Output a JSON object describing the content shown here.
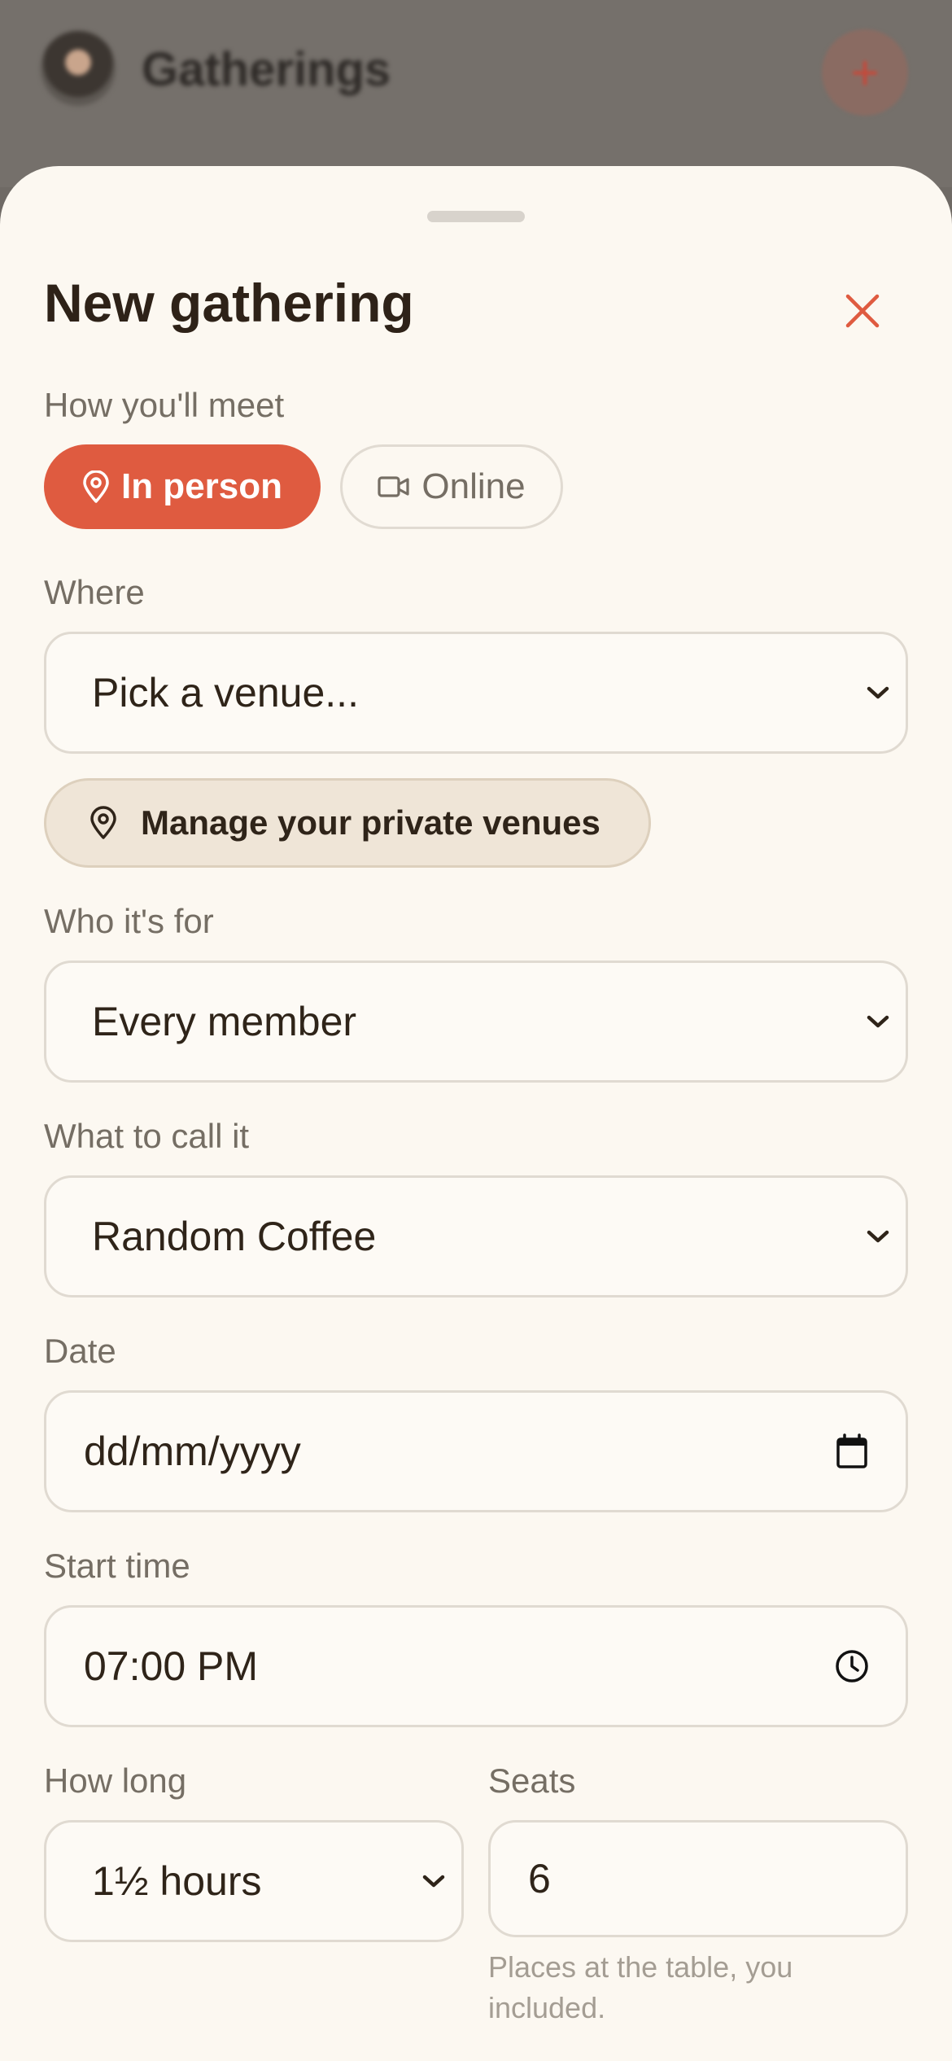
{
  "background_app": {
    "title": "Gatherings",
    "add_button": "+"
  },
  "sheet": {
    "title": "New gathering",
    "close_icon": "close-x-icon"
  },
  "meeting_mode": {
    "label": "How you'll meet",
    "options": [
      {
        "label": "In person",
        "icon": "map-pin-icon",
        "selected": true
      },
      {
        "label": "Online",
        "icon": "video-camera-icon",
        "selected": false
      }
    ]
  },
  "where": {
    "label": "Where",
    "value": "Pick a venue...",
    "manage_button": "Manage your private venues"
  },
  "audience": {
    "label": "Who it's for",
    "value": "Every member"
  },
  "name": {
    "label": "What to call it",
    "value": "Random Coffee"
  },
  "date": {
    "label": "Date",
    "value": "dd/mm/yyyy"
  },
  "start_time": {
    "label": "Start time",
    "value": "07:00 PM"
  },
  "duration": {
    "label": "How long",
    "value": "1½ hours"
  },
  "seats": {
    "label": "Seats",
    "value": "6",
    "hint": "Places at the table, you included."
  },
  "colors": {
    "accent": "#df5b40",
    "sheet_bg": "#fcf8f1",
    "text": "#2f2419",
    "muted": "#756e64"
  }
}
